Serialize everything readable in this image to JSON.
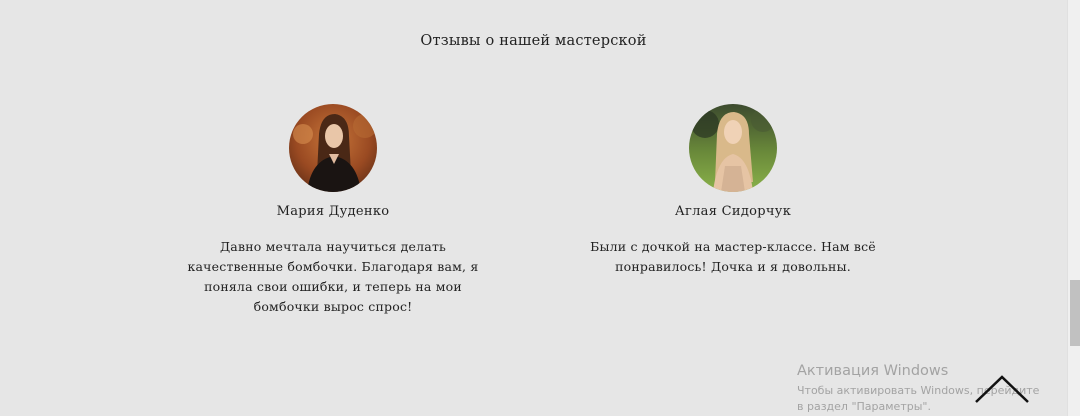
{
  "section": {
    "title": "Отзывы о нашей мастерской"
  },
  "reviews": [
    {
      "name": "Мария Дуденко",
      "text": "Давно мечтала научиться делать качественные бомбочки. Благодаря вам, я поняла свои ошибки, и теперь на мои бомбочки вырос спрос!",
      "avatar_icon": "woman-portrait-autumn"
    },
    {
      "name": "Аглая Сидорчук",
      "text": "Были с дочкой на мастер-классе. Нам всё понравилось! Дочка и я довольны.",
      "avatar_icon": "woman-portrait-park"
    }
  ],
  "watermark": {
    "title": "Активация Windows",
    "subtitle": "Чтобы активировать Windows, перейдите в раздел \"Параметры\"."
  },
  "scroll_top": {
    "icon": "chevron-up-icon"
  },
  "colors": {
    "background": "#e6e6e6",
    "text": "#222222"
  }
}
